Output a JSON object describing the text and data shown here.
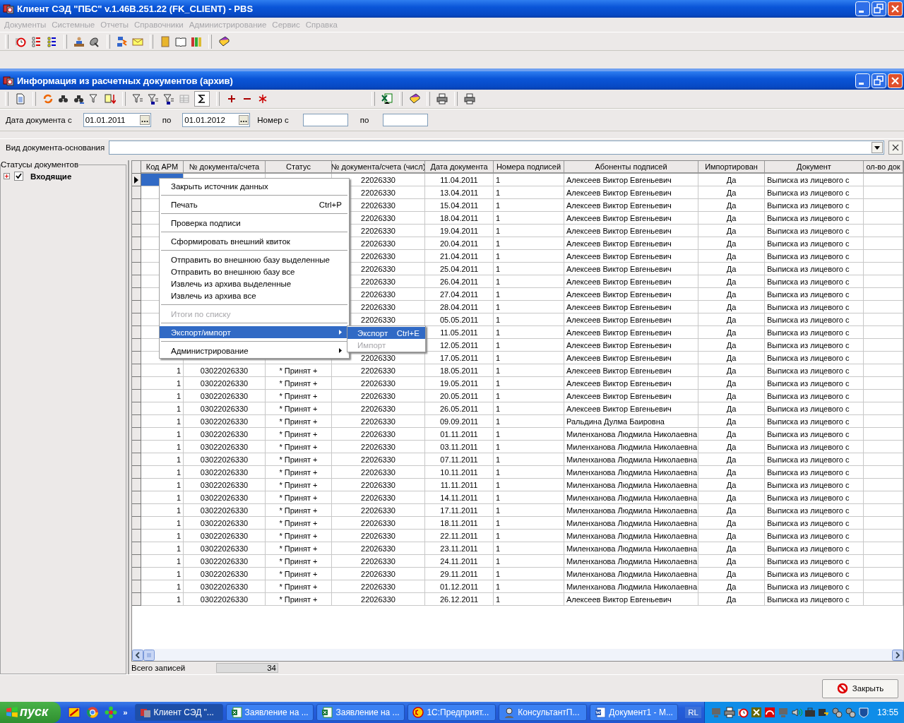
{
  "window": {
    "title": "Клиент СЭД \"ПБС\" v.1.46B.251.22 (FK_CLIENT) - PBS"
  },
  "menu": [
    {
      "label": "Документы",
      "disabled": true
    },
    {
      "label": "Системные",
      "disabled": true
    },
    {
      "label": "Отчеты",
      "disabled": true
    },
    {
      "label": "Справочники",
      "disabled": true
    },
    {
      "label": "Администрирование",
      "disabled": true
    },
    {
      "label": "Сервис",
      "disabled": true
    },
    {
      "label": "Справка",
      "disabled": true
    }
  ],
  "child_window": {
    "title": "Информация из расчетных документов (архив)"
  },
  "filters": {
    "date_from_label": "Дата документа с",
    "date_from": "01.01.2011",
    "date_to_label": "по",
    "date_to": "01.01.2012",
    "number_from_label": "Номер с",
    "number_to_label": "по",
    "basis_label": "Вид документа-основания"
  },
  "statuses": {
    "title": "Статусы документов",
    "items": [
      {
        "label": "Входящие",
        "checked": true,
        "expanded": false
      }
    ]
  },
  "table": {
    "columns": [
      "Код АРМ",
      "№ документа/счета",
      "Статус",
      "№ документа/счета (числ)",
      "Дата документа",
      "Номера подписей",
      "Абоненты подписей",
      "Импортирован",
      "Документ",
      "ол-во док"
    ],
    "rows": [
      {
        "selected": true,
        "numc": "22026330",
        "date": "11.04.2011",
        "sigs": "1",
        "abonent": "Алексеев Виктор Евгеньевич",
        "imported": "Да",
        "document": "Выписка из лицевого с"
      },
      {
        "selected": false,
        "numc": "22026330",
        "date": "13.04.2011",
        "sigs": "1",
        "abonent": "Алексеев Виктор Евгеньевич",
        "imported": "Да",
        "document": "Выписка из лицевого с"
      },
      {
        "selected": false,
        "numc": "22026330",
        "date": "15.04.2011",
        "sigs": "1",
        "abonent": "Алексеев Виктор Евгеньевич",
        "imported": "Да",
        "document": "Выписка из лицевого с"
      },
      {
        "selected": false,
        "numc": "22026330",
        "date": "18.04.2011",
        "sigs": "1",
        "abonent": "Алексеев Виктор Евгеньевич",
        "imported": "Да",
        "document": "Выписка из лицевого с"
      },
      {
        "selected": false,
        "numc": "22026330",
        "date": "19.04.2011",
        "sigs": "1",
        "abonent": "Алексеев Виктор Евгеньевич",
        "imported": "Да",
        "document": "Выписка из лицевого с"
      },
      {
        "selected": false,
        "numc": "22026330",
        "date": "20.04.2011",
        "sigs": "1",
        "abonent": "Алексеев Виктор Евгеньевич",
        "imported": "Да",
        "document": "Выписка из лицевого с"
      },
      {
        "selected": false,
        "numc": "22026330",
        "date": "21.04.2011",
        "sigs": "1",
        "abonent": "Алексеев Виктор Евгеньевич",
        "imported": "Да",
        "document": "Выписка из лицевого с"
      },
      {
        "selected": false,
        "numc": "22026330",
        "date": "25.04.2011",
        "sigs": "1",
        "abonent": "Алексеев Виктор Евгеньевич",
        "imported": "Да",
        "document": "Выписка из лицевого с"
      },
      {
        "selected": false,
        "numc": "22026330",
        "date": "26.04.2011",
        "sigs": "1",
        "abonent": "Алексеев Виктор Евгеньевич",
        "imported": "Да",
        "document": "Выписка из лицевого с"
      },
      {
        "selected": false,
        "numc": "22026330",
        "date": "27.04.2011",
        "sigs": "1",
        "abonent": "Алексеев Виктор Евгеньевич",
        "imported": "Да",
        "document": "Выписка из лицевого с"
      },
      {
        "selected": false,
        "numc": "22026330",
        "date": "28.04.2011",
        "sigs": "1",
        "abonent": "Алексеев Виктор Евгеньевич",
        "imported": "Да",
        "document": "Выписка из лицевого с"
      },
      {
        "selected": false,
        "numc": "22026330",
        "date": "05.05.2011",
        "sigs": "1",
        "abonent": "Алексеев Виктор Евгеньевич",
        "imported": "Да",
        "document": "Выписка из лицевого с"
      },
      {
        "selected": false,
        "date": "11.05.2011",
        "sigs": "1",
        "abonent": "Алексеев Виктор Евгеньевич",
        "imported": "Да",
        "document": "Выписка из лицевого с"
      },
      {
        "selected": false,
        "date": "12.05.2011",
        "sigs": "1",
        "abonent": "Алексеев Виктор Евгеньевич",
        "imported": "Да",
        "document": "Выписка из лицевого с"
      },
      {
        "selected": false,
        "numc": "22026330",
        "date": "17.05.2011",
        "sigs": "1",
        "abonent": "Алексеев Виктор Евгеньевич",
        "imported": "Да",
        "document": "Выписка из лицевого с"
      },
      {
        "selected": false,
        "arm": "1",
        "doc": "03022026330",
        "status": "* Принят +",
        "numc": "22026330",
        "date": "18.05.2011",
        "sigs": "1",
        "abonent": "Алексеев Виктор Евгеньевич",
        "imported": "Да",
        "document": "Выписка из лицевого с"
      },
      {
        "selected": false,
        "arm": "1",
        "doc": "03022026330",
        "status": "* Принят +",
        "numc": "22026330",
        "date": "19.05.2011",
        "sigs": "1",
        "abonent": "Алексеев Виктор Евгеньевич",
        "imported": "Да",
        "document": "Выписка из лицевого с"
      },
      {
        "selected": false,
        "arm": "1",
        "doc": "03022026330",
        "status": "* Принят +",
        "numc": "22026330",
        "date": "20.05.2011",
        "sigs": "1",
        "abonent": "Алексеев Виктор Евгеньевич",
        "imported": "Да",
        "document": "Выписка из лицевого с"
      },
      {
        "selected": false,
        "arm": "1",
        "doc": "03022026330",
        "status": "* Принят +",
        "numc": "22026330",
        "date": "26.05.2011",
        "sigs": "1",
        "abonent": "Алексеев Виктор Евгеньевич",
        "imported": "Да",
        "document": "Выписка из лицевого с"
      },
      {
        "selected": false,
        "arm": "1",
        "doc": "03022026330",
        "status": "* Принят +",
        "numc": "22026330",
        "date": "09.09.2011",
        "sigs": "1",
        "abonent": "Ральдина Дулма Баировна",
        "imported": "Да",
        "document": "Выписка из лицевого с"
      },
      {
        "selected": false,
        "arm": "1",
        "doc": "03022026330",
        "status": "* Принят +",
        "numc": "22026330",
        "date": "01.11.2011",
        "sigs": "1",
        "abonent": "Миленханова Людмила Николаевна",
        "imported": "Да",
        "document": "Выписка из лицевого с"
      },
      {
        "selected": false,
        "arm": "1",
        "doc": "03022026330",
        "status": "* Принят +",
        "numc": "22026330",
        "date": "03.11.2011",
        "sigs": "1",
        "abonent": "Миленханова Людмила Николаевна",
        "imported": "Да",
        "document": "Выписка из лицевого с"
      },
      {
        "selected": false,
        "arm": "1",
        "doc": "03022026330",
        "status": "* Принят +",
        "numc": "22026330",
        "date": "07.11.2011",
        "sigs": "1",
        "abonent": "Миленханова Людмила Николаевна",
        "imported": "Да",
        "document": "Выписка из лицевого с"
      },
      {
        "selected": false,
        "arm": "1",
        "doc": "03022026330",
        "status": "* Принят +",
        "numc": "22026330",
        "date": "10.11.2011",
        "sigs": "1",
        "abonent": "Миленханова Людмила Николаевна",
        "imported": "Да",
        "document": "Выписка из лицевого с"
      },
      {
        "selected": false,
        "arm": "1",
        "doc": "03022026330",
        "status": "* Принят +",
        "numc": "22026330",
        "date": "11.11.2011",
        "sigs": "1",
        "abonent": "Миленханова Людмила Николаевна",
        "imported": "Да",
        "document": "Выписка из лицевого с"
      },
      {
        "selected": false,
        "arm": "1",
        "doc": "03022026330",
        "status": "* Принят +",
        "numc": "22026330",
        "date": "14.11.2011",
        "sigs": "1",
        "abonent": "Миленханова Людмила Николаевна",
        "imported": "Да",
        "document": "Выписка из лицевого с"
      },
      {
        "selected": false,
        "arm": "1",
        "doc": "03022026330",
        "status": "* Принят +",
        "numc": "22026330",
        "date": "17.11.2011",
        "sigs": "1",
        "abonent": "Миленханова Людмила Николаевна",
        "imported": "Да",
        "document": "Выписка из лицевого с"
      },
      {
        "selected": false,
        "arm": "1",
        "doc": "03022026330",
        "status": "* Принят +",
        "numc": "22026330",
        "date": "18.11.2011",
        "sigs": "1",
        "abonent": "Миленханова Людмила Николаевна",
        "imported": "Да",
        "document": "Выписка из лицевого с"
      },
      {
        "selected": false,
        "arm": "1",
        "doc": "03022026330",
        "status": "* Принят +",
        "numc": "22026330",
        "date": "22.11.2011",
        "sigs": "1",
        "abonent": "Миленханова Людмила Николаевна",
        "imported": "Да",
        "document": "Выписка из лицевого с"
      },
      {
        "selected": false,
        "arm": "1",
        "doc": "03022026330",
        "status": "* Принят +",
        "numc": "22026330",
        "date": "23.11.2011",
        "sigs": "1",
        "abonent": "Миленханова Людмила Николаевна",
        "imported": "Да",
        "document": "Выписка из лицевого с"
      },
      {
        "selected": false,
        "arm": "1",
        "doc": "03022026330",
        "status": "* Принят +",
        "numc": "22026330",
        "date": "24.11.2011",
        "sigs": "1",
        "abonent": "Миленханова Людмила Николаевна",
        "imported": "Да",
        "document": "Выписка из лицевого с"
      },
      {
        "selected": false,
        "arm": "1",
        "doc": "03022026330",
        "status": "* Принят +",
        "numc": "22026330",
        "date": "29.11.2011",
        "sigs": "1",
        "abonent": "Миленханова Людмила Николаевна",
        "imported": "Да",
        "document": "Выписка из лицевого с"
      },
      {
        "selected": false,
        "arm": "1",
        "doc": "03022026330",
        "status": "* Принят +",
        "numc": "22026330",
        "date": "01.12.2011",
        "sigs": "1",
        "abonent": "Миленханова Людмила Николаевна",
        "imported": "Да",
        "document": "Выписка из лицевого с"
      },
      {
        "selected": false,
        "arm": "1",
        "doc": "03022026330",
        "status": "* Принят +",
        "numc": "22026330",
        "date": "26.12.2011",
        "sigs": "1",
        "abonent": "Алексеев Виктор Евгеньевич",
        "imported": "Да",
        "document": "Выписка из лицевого с"
      }
    ]
  },
  "context_menu": {
    "groups": [
      [
        {
          "label": "Закрыть источник данных",
          "disabled": false,
          "selected": false,
          "submenu": false
        }
      ],
      [
        {
          "label": "Печать",
          "shortcut": "Ctrl+P",
          "disabled": false,
          "selected": false,
          "submenu": false
        }
      ],
      [
        {
          "label": "Проверка подписи",
          "disabled": false,
          "selected": false,
          "submenu": false
        }
      ],
      [
        {
          "label": "Сформировать внешний квиток",
          "disabled": false,
          "selected": false,
          "submenu": false
        }
      ],
      [
        {
          "label": "Отправить во внешнюю базу выделенные",
          "disabled": false,
          "selected": false,
          "submenu": false
        },
        {
          "label": "Отправить во внешнюю базу все",
          "disabled": false,
          "selected": false,
          "submenu": false
        },
        {
          "label": "Извлечь из архива выделенные",
          "disabled": false,
          "selected": false,
          "submenu": false
        },
        {
          "label": "Извлечь из архива все",
          "disabled": false,
          "selected": false,
          "submenu": false
        }
      ],
      [
        {
          "label": "Итоги по списку",
          "disabled": true,
          "selected": false,
          "submenu": false
        }
      ],
      [
        {
          "label": "Экспорт/импорт",
          "disabled": false,
          "selected": true,
          "submenu": true
        }
      ],
      [
        {
          "label": "Администрирование",
          "disabled": false,
          "selected": false,
          "submenu": true
        }
      ]
    ],
    "submenu": [
      {
        "label": "Экспорт",
        "shortcut": "Ctrl+E",
        "disabled": false,
        "selected": true
      },
      {
        "label": "Импорт",
        "disabled": true,
        "selected": false
      }
    ]
  },
  "status_bar": {
    "label": "Всего записей",
    "count": "34"
  },
  "close_button": {
    "label": "Закрыть"
  },
  "taskbar": {
    "start": "пуск",
    "more": "»",
    "tasks": [
      {
        "label": "Клиент СЭД \"...",
        "selected": true,
        "kind": "app"
      },
      {
        "label": "Заявление на ...",
        "selected": false,
        "kind": "sheet"
      },
      {
        "label": "Заявление на ...",
        "selected": false,
        "kind": "sheet"
      },
      {
        "label": "1С:Предприят...",
        "selected": false,
        "kind": "onec"
      },
      {
        "label": "КонсультантП...",
        "selected": false,
        "kind": "person"
      },
      {
        "label": "Документ1 - М...",
        "selected": false,
        "kind": "word"
      }
    ],
    "language": "RL",
    "clock": "13:55"
  }
}
